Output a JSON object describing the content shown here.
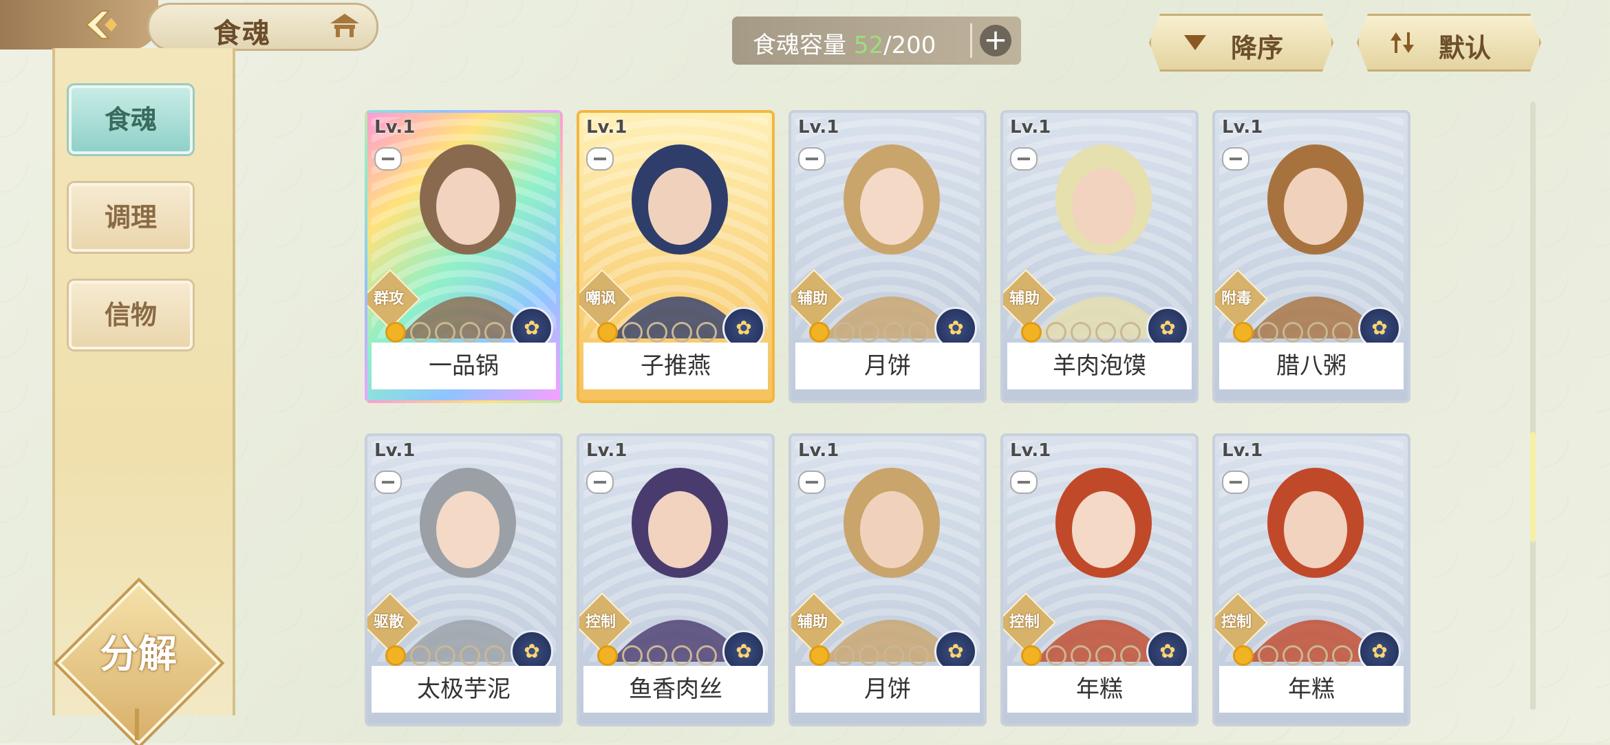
{
  "nav": {
    "title": "食魂"
  },
  "capacity": {
    "label": "食魂容量 ",
    "current": "52",
    "total": "/200"
  },
  "sort": {
    "order_label": "降序",
    "default_label": "默认"
  },
  "sidebar": {
    "items": [
      {
        "label": "食魂"
      },
      {
        "label": "调理"
      },
      {
        "label": "信物"
      }
    ]
  },
  "decompose_label": "分解",
  "cards": [
    {
      "level": "Lv.1",
      "role": "群攻",
      "name": "一品锅",
      "rarity": "rainbow",
      "stars": 1,
      "emblem": "flower-emblem"
    },
    {
      "level": "Lv.1",
      "role": "嘲讽",
      "name": "子推燕",
      "rarity": "gold",
      "stars": 1,
      "emblem": "flower-emblem"
    },
    {
      "level": "Lv.1",
      "role": "辅助",
      "name": "月饼",
      "rarity": "blue",
      "stars": 1,
      "emblem": "leaf-emblem"
    },
    {
      "level": "Lv.1",
      "role": "辅助",
      "name": "羊肉泡馍",
      "rarity": "blue",
      "stars": 1,
      "emblem": "leaf-emblem"
    },
    {
      "level": "Lv.1",
      "role": "附毒",
      "name": "腊八粥",
      "rarity": "blue",
      "stars": 1,
      "emblem": "drop-emblem"
    },
    {
      "level": "Lv.1",
      "role": "驱散",
      "name": "太极芋泥",
      "rarity": "blue",
      "stars": 1,
      "emblem": "drop-emblem"
    },
    {
      "level": "Lv.1",
      "role": "控制",
      "name": "鱼香肉丝",
      "rarity": "blue",
      "stars": 1,
      "emblem": "drop-emblem"
    },
    {
      "level": "Lv.1",
      "role": "辅助",
      "name": "月饼",
      "rarity": "blue",
      "stars": 1,
      "emblem": "flower-emblem"
    },
    {
      "level": "Lv.1",
      "role": "控制",
      "name": "年糕",
      "rarity": "blue",
      "stars": 1,
      "emblem": "flower-emblem"
    },
    {
      "level": "Lv.1",
      "role": "控制",
      "name": "年糕",
      "rarity": "blue",
      "stars": 1,
      "emblem": "flower-emblem"
    }
  ],
  "colors": {
    "accent_teal": "#8fd1c8",
    "gold": "#d8b06a",
    "capacity_green": "#9be07d"
  }
}
